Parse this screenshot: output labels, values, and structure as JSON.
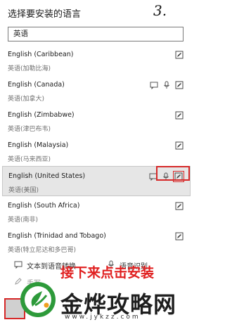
{
  "header": {
    "title": "选择要安装的语言",
    "step_marker": "3."
  },
  "search": {
    "value": "英语"
  },
  "languages": [
    {
      "name": "English (Caribbean)",
      "native": "英语(加勒比海)",
      "features": [
        "handwriting"
      ]
    },
    {
      "name": "English (Canada)",
      "native": "英语(加拿大)",
      "features": [
        "tts",
        "speech",
        "handwriting"
      ]
    },
    {
      "name": "English (Zimbabwe)",
      "native": "英语(津巴布韦)",
      "features": [
        "handwriting"
      ]
    },
    {
      "name": "English (Malaysia)",
      "native": "英语(马来西亚)",
      "features": [
        "handwriting"
      ]
    },
    {
      "name": "English (United States)",
      "native": "英语(美国)",
      "features": [
        "tts",
        "speech",
        "handwriting"
      ],
      "selected": true
    },
    {
      "name": "English (South Africa)",
      "native": "英语(南非)",
      "features": [
        "handwriting"
      ]
    },
    {
      "name": "English (Trinidad and Tobago)",
      "native": "英语(特立尼达和多巴哥)",
      "features": [
        "handwriting"
      ]
    }
  ],
  "features": {
    "tts_label": "文本到语音转换",
    "speech_label": "语音识别",
    "handwriting_label": "手写"
  },
  "annotation": {
    "instruction": "接下来点击安装",
    "color": "#e02020"
  },
  "watermark": {
    "brand": "金烨攻略网",
    "domain": "www.jykzz.com"
  }
}
